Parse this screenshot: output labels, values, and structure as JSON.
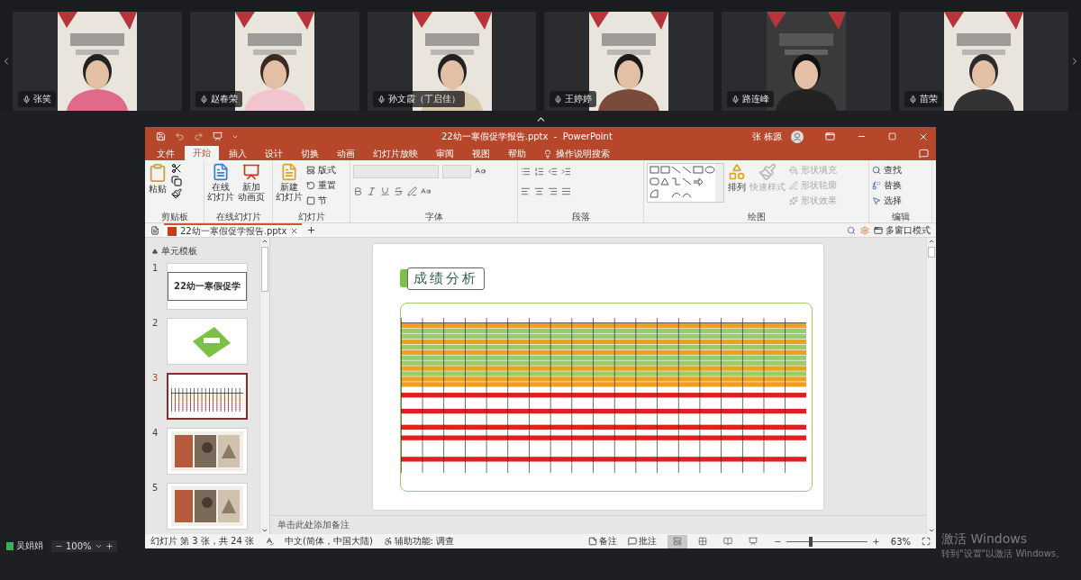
{
  "participants": [
    {
      "name": "张笑"
    },
    {
      "name": "赵春荣"
    },
    {
      "name": "孙文霞（丁启佳）"
    },
    {
      "name": "王婷婷"
    },
    {
      "name": "路连峰"
    },
    {
      "name": "苗荣"
    }
  ],
  "self_view": {
    "name": "吴娟娟",
    "zoom": "100%"
  },
  "powerpoint": {
    "title": "22幼一寒假促学报告.pptx  -  PowerPoint",
    "user": "张 栋源",
    "tabs": [
      {
        "label": "文件",
        "selected": false
      },
      {
        "label": "开始",
        "selected": true
      },
      {
        "label": "插入",
        "selected": false
      },
      {
        "label": "设计",
        "selected": false
      },
      {
        "label": "切换",
        "selected": false
      },
      {
        "label": "动画",
        "selected": false
      },
      {
        "label": "幻灯片放映",
        "selected": false
      },
      {
        "label": "审阅",
        "selected": false
      },
      {
        "label": "视图",
        "selected": false
      },
      {
        "label": "帮助",
        "selected": false
      }
    ],
    "tell_me": "操作说明搜索",
    "ribbon": {
      "clipboard": {
        "label": "剪贴板",
        "paste": "粘贴"
      },
      "online_slides": {
        "label": "在线幻灯片",
        "buttons": [
          {
            "lines": [
              "在线",
              "幻灯片"
            ]
          },
          {
            "lines": [
              "新加",
              "动画页"
            ]
          }
        ]
      },
      "slides": {
        "label": "幻灯片",
        "new_slide": [
          "新建",
          "幻灯片"
        ],
        "items": [
          {
            "label": "版式"
          },
          {
            "label": "重置"
          },
          {
            "label": "节"
          }
        ]
      },
      "font": {
        "label": "字体"
      },
      "paragraph": {
        "label": "段落"
      },
      "drawing": {
        "label": "绘图",
        "arrange": "排列",
        "quick_styles": {
          "label": "快速样式",
          "disabled": true
        },
        "items": [
          {
            "label": "形状填充",
            "disabled": true
          },
          {
            "label": "形状轮廓",
            "disabled": true
          },
          {
            "label": "形状效果",
            "disabled": true
          }
        ]
      },
      "editing": {
        "label": "编辑",
        "items": [
          {
            "label": "查找"
          },
          {
            "label": "替换"
          },
          {
            "label": "选择"
          }
        ]
      }
    },
    "document_tab": "22幼一寒假促学报告.pptx",
    "multi_window": "多窗口模式",
    "section": "单元模板",
    "thumbnails": [
      {
        "number": "1",
        "kind": "title",
        "title": "22幼一寒假促学",
        "selected": false
      },
      {
        "number": "2",
        "kind": "shape",
        "selected": false
      },
      {
        "number": "3",
        "kind": "table",
        "selected": true
      },
      {
        "number": "4",
        "kind": "picture",
        "selected": false
      },
      {
        "number": "5",
        "kind": "picture",
        "selected": false
      }
    ],
    "slide": {
      "title": "成绩分析"
    },
    "notes_placeholder": "单击此处添加备注",
    "status": {
      "slide_info": "幻灯片 第 3 张，共 24 张",
      "language": "中文(简体，中国大陆)",
      "accessibility": "辅助功能: 调查",
      "notes": "备注",
      "comments": "批注",
      "views": [
        {
          "kind": "normal",
          "selected": true
        },
        {
          "kind": "sorter",
          "selected": false
        },
        {
          "kind": "reading",
          "selected": false
        },
        {
          "kind": "slideshow",
          "selected": false
        }
      ],
      "zoom": {
        "level": 0.3,
        "reading": "63%"
      }
    }
  },
  "activation_notice": {
    "title": "激活 Windows",
    "subtitle": "转到\"设置\"以激活 Windows。"
  }
}
